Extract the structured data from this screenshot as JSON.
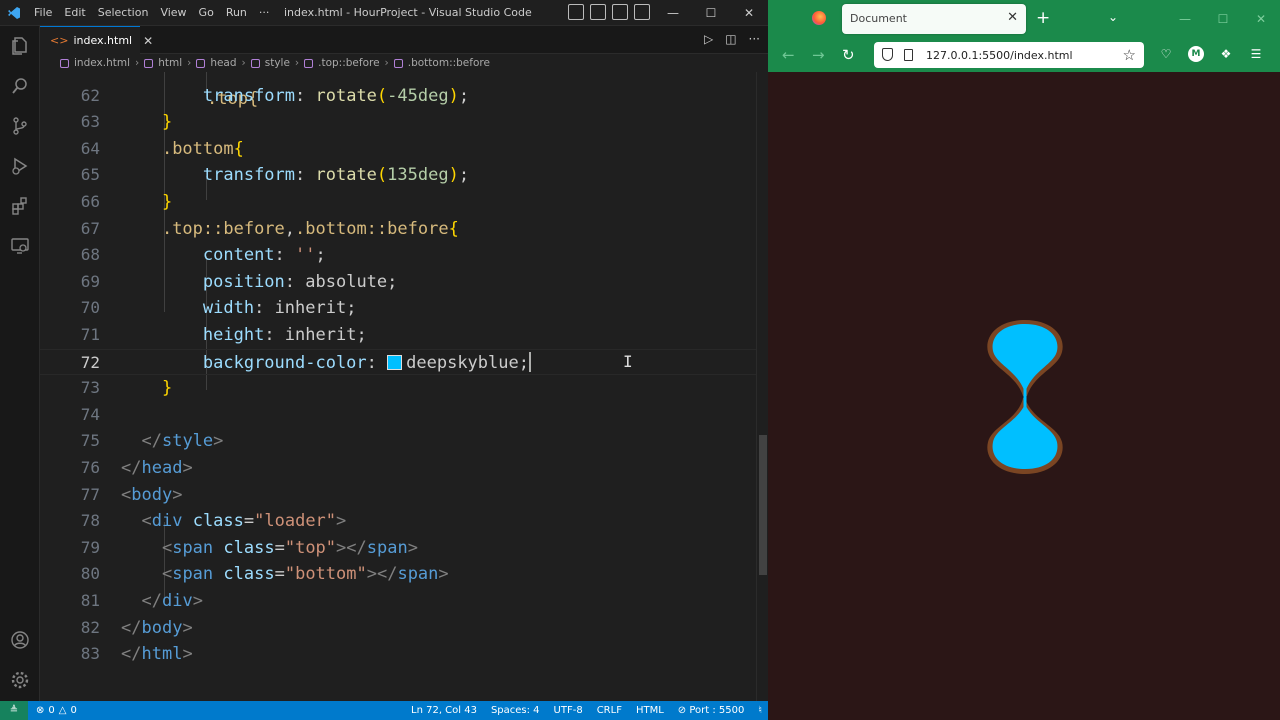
{
  "colors": {
    "accent": "#007acc",
    "browser_green": "#1b8a4b",
    "page_bg": "#2b1616",
    "loader_fill": "#00bfff",
    "loader_border": "#7a4523"
  },
  "vscode": {
    "menu": [
      "File",
      "Edit",
      "Selection",
      "View",
      "Go",
      "Run",
      "···"
    ],
    "window_title": "index.html - HourProject - Visual Studio Code",
    "tab_label": "index.html",
    "breadcrumb": [
      "index.html",
      "html",
      "head",
      "style",
      ".top::before",
      ".bottom::before"
    ],
    "partial_top_line": ".top{",
    "lines": [
      {
        "num": "62",
        "indent": "        ",
        "tokens": [
          [
            "t-prop",
            "transform"
          ],
          [
            "t-pun",
            ": "
          ],
          [
            "t-fn",
            "rotate"
          ],
          [
            "t-br",
            "("
          ],
          [
            "t-num",
            "-45deg"
          ],
          [
            "t-br",
            ")"
          ],
          [
            "t-pun",
            ";"
          ]
        ]
      },
      {
        "num": "63",
        "indent": "    ",
        "tokens": [
          [
            "t-br",
            "}"
          ]
        ]
      },
      {
        "num": "64",
        "indent": "    ",
        "tokens": [
          [
            "t-sel",
            ".bottom"
          ],
          [
            "t-br",
            "{"
          ]
        ]
      },
      {
        "num": "65",
        "indent": "        ",
        "tokens": [
          [
            "t-prop",
            "transform"
          ],
          [
            "t-pun",
            ": "
          ],
          [
            "t-fn",
            "rotate"
          ],
          [
            "t-br",
            "("
          ],
          [
            "t-num",
            "135deg"
          ],
          [
            "t-br",
            ")"
          ],
          [
            "t-pun",
            ";"
          ]
        ]
      },
      {
        "num": "66",
        "indent": "    ",
        "tokens": [
          [
            "t-br",
            "}"
          ]
        ]
      },
      {
        "num": "67",
        "indent": "    ",
        "tokens": [
          [
            "t-sel",
            ".top::before"
          ],
          [
            "t-pun",
            ","
          ],
          [
            "t-sel",
            ".bottom::before"
          ],
          [
            "t-br",
            "{"
          ]
        ]
      },
      {
        "num": "68",
        "indent": "        ",
        "tokens": [
          [
            "t-prop",
            "content"
          ],
          [
            "t-pun",
            ": "
          ],
          [
            "t-val",
            "''"
          ],
          [
            "t-pun",
            ";"
          ]
        ]
      },
      {
        "num": "69",
        "indent": "        ",
        "tokens": [
          [
            "t-prop",
            "position"
          ],
          [
            "t-pun",
            ": "
          ],
          [
            "t-pun",
            "absolute"
          ],
          [
            "t-pun",
            ";"
          ]
        ]
      },
      {
        "num": "70",
        "indent": "        ",
        "tokens": [
          [
            "t-prop",
            "width"
          ],
          [
            "t-pun",
            ": "
          ],
          [
            "t-pun",
            "inherit"
          ],
          [
            "t-pun",
            ";"
          ]
        ]
      },
      {
        "num": "71",
        "indent": "        ",
        "tokens": [
          [
            "t-prop",
            "height"
          ],
          [
            "t-pun",
            ": "
          ],
          [
            "t-pun",
            "inherit"
          ],
          [
            "t-pun",
            ";"
          ]
        ]
      },
      {
        "num": "72",
        "indent": "        ",
        "tokens": [
          [
            "t-prop",
            "background-color"
          ],
          [
            "t-pun",
            ": "
          ],
          [
            "swatch",
            ""
          ],
          [
            "t-pun",
            "deepskyblue"
          ],
          [
            "t-pun",
            ";"
          ],
          [
            "caret",
            ""
          ]
        ]
      },
      {
        "num": "73",
        "indent": "    ",
        "tokens": [
          [
            "t-br",
            "}"
          ]
        ]
      },
      {
        "num": "74",
        "indent": "",
        "tokens": []
      },
      {
        "num": "75",
        "indent": "  ",
        "tokens": [
          [
            "t-ang",
            "</"
          ],
          [
            "t-tag",
            "style"
          ],
          [
            "t-ang",
            ">"
          ]
        ]
      },
      {
        "num": "76",
        "indent": "",
        "tokens": [
          [
            "t-ang",
            "</"
          ],
          [
            "t-tag",
            "head"
          ],
          [
            "t-ang",
            ">"
          ]
        ]
      },
      {
        "num": "77",
        "indent": "",
        "tokens": [
          [
            "t-ang",
            "<"
          ],
          [
            "t-tag",
            "body"
          ],
          [
            "t-ang",
            ">"
          ]
        ]
      },
      {
        "num": "78",
        "indent": "  ",
        "tokens": [
          [
            "t-ang",
            "<"
          ],
          [
            "t-tag",
            "div"
          ],
          [
            "t-pun",
            " "
          ],
          [
            "t-attr",
            "class"
          ],
          [
            "t-pun",
            "="
          ],
          [
            "t-str",
            "\"loader\""
          ],
          [
            "t-ang",
            ">"
          ]
        ]
      },
      {
        "num": "79",
        "indent": "    ",
        "tokens": [
          [
            "t-ang",
            "<"
          ],
          [
            "t-tag",
            "span"
          ],
          [
            "t-pun",
            " "
          ],
          [
            "t-attr",
            "class"
          ],
          [
            "t-pun",
            "="
          ],
          [
            "t-str",
            "\"top\""
          ],
          [
            "t-ang",
            "></"
          ],
          [
            "t-tag",
            "span"
          ],
          [
            "t-ang",
            ">"
          ]
        ]
      },
      {
        "num": "80",
        "indent": "    ",
        "tokens": [
          [
            "t-ang",
            "<"
          ],
          [
            "t-tag",
            "span"
          ],
          [
            "t-pun",
            " "
          ],
          [
            "t-attr",
            "class"
          ],
          [
            "t-pun",
            "="
          ],
          [
            "t-str",
            "\"bottom\""
          ],
          [
            "t-ang",
            "></"
          ],
          [
            "t-tag",
            "span"
          ],
          [
            "t-ang",
            ">"
          ]
        ]
      },
      {
        "num": "81",
        "indent": "  ",
        "tokens": [
          [
            "t-ang",
            "</"
          ],
          [
            "t-tag",
            "div"
          ],
          [
            "t-ang",
            ">"
          ]
        ]
      },
      {
        "num": "82",
        "indent": "",
        "tokens": [
          [
            "t-ang",
            "</"
          ],
          [
            "t-tag",
            "body"
          ],
          [
            "t-ang",
            ">"
          ]
        ]
      },
      {
        "num": "83",
        "indent": "",
        "tokens": [
          [
            "t-ang",
            "</"
          ],
          [
            "t-tag",
            "html"
          ],
          [
            "t-ang",
            ">"
          ]
        ]
      }
    ],
    "active_line": "72",
    "status": {
      "errors": "0",
      "warnings": "0",
      "position": "Ln 72, Col 43",
      "spaces": "Spaces: 4",
      "encoding": "UTF-8",
      "eol": "CRLF",
      "language": "HTML",
      "port": "Port : 5500"
    }
  },
  "browser": {
    "tab_title": "Document",
    "url": "127.0.0.1:5500/index.html",
    "profile_initial": "M"
  }
}
